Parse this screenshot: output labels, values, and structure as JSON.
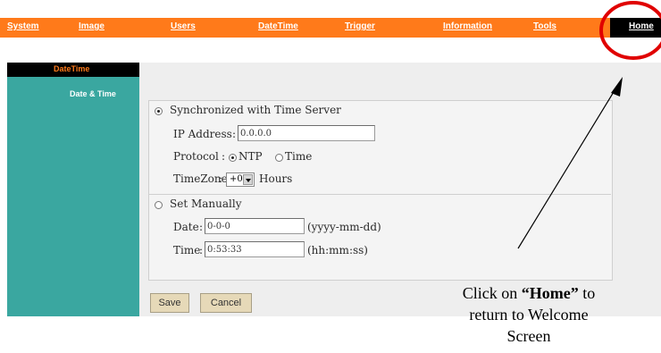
{
  "nav": {
    "items": [
      "System",
      "Image",
      "Users",
      "DateTime",
      "Trigger",
      "Information",
      "Tools"
    ],
    "home": "Home"
  },
  "sidebar": {
    "section": "DateTime",
    "item": "Date & Time"
  },
  "form": {
    "sync_label": "Synchronized with Time Server",
    "ip_label": "IP Address",
    "ip_value": "0.0.0.0",
    "protocol_label": "Protocol",
    "protocol_options": [
      "NTP",
      "Time"
    ],
    "protocol_selected": "NTP",
    "timezone_label": "TimeZone",
    "timezone_value": "+0",
    "hours_label": "Hours",
    "manual_label": "Set Manually",
    "date_label": "Date",
    "date_value": "0-0-0",
    "date_format": "(yyyy-mm-dd)",
    "time_label": "Time",
    "time_value": "0:53:33",
    "time_format": "(hh:mm:ss)",
    "save_label": "Save",
    "cancel_label": "Cancel"
  },
  "annotation": {
    "prefix": "Click on ",
    "emphasis": "“Home”",
    "line1_suffix": " to",
    "line2": "return to Welcome",
    "line3": "Screen"
  },
  "colors": {
    "nav_bar": "#ff7a1a",
    "sidebar": "#3aa7a0",
    "highlight_circle": "#e00000"
  }
}
